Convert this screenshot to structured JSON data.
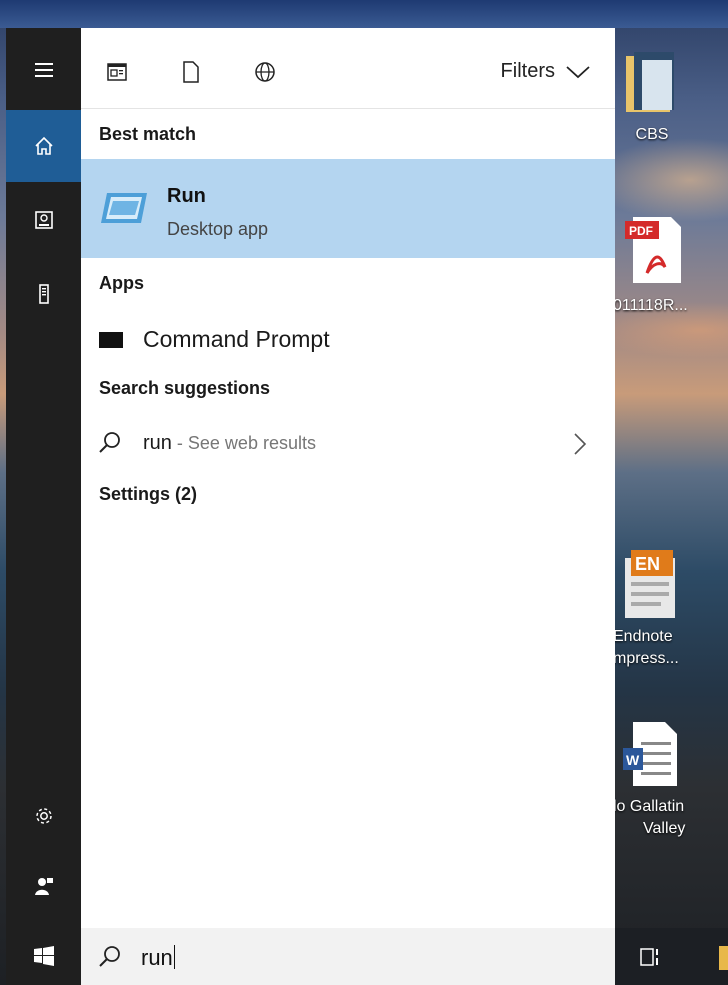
{
  "search_panel": {
    "filters_label": "Filters",
    "best_match_heading": "Best match",
    "best_match": {
      "title": "Run",
      "subtitle": "Desktop app"
    },
    "apps_heading": "Apps",
    "apps": [
      {
        "label": "Command Prompt"
      }
    ],
    "suggestions_heading": "Search suggestions",
    "suggestions": [
      {
        "query": "run",
        "hint": " - See web results"
      }
    ],
    "settings_heading": "Settings (2)"
  },
  "search_box": {
    "value": "run"
  },
  "desktop_icons": [
    {
      "label": "CBS"
    },
    {
      "label": "011118R..."
    },
    {
      "label_line1": "Endnote",
      "label_line2": "mpress..."
    },
    {
      "label_line1": "lo Gallatin",
      "label_line2": "Valley"
    }
  ],
  "icons": {
    "menu": "hamburger-icon",
    "home": "home-icon",
    "documents": "device-icon",
    "phone": "tower-icon",
    "settings": "gear-icon",
    "user": "user-icon",
    "start": "windows-icon",
    "search": "search-icon"
  },
  "colors": {
    "accent": "#1f5d96",
    "highlight": "#b4d5f0",
    "rail": "#1f1f1f"
  }
}
